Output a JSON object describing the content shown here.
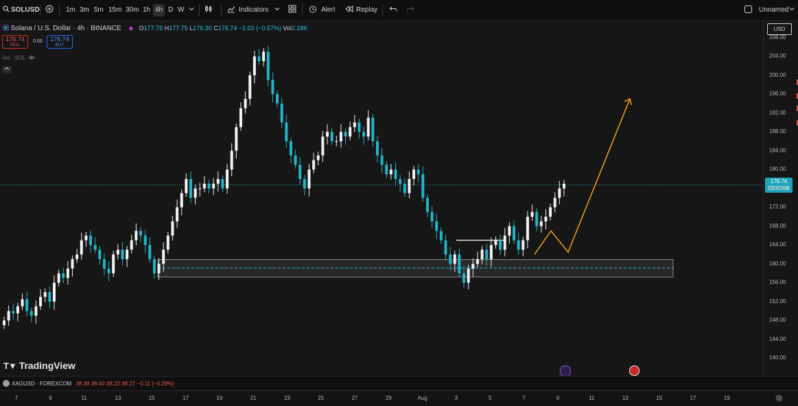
{
  "toolbar": {
    "symbol": "SOLUSD",
    "intervals": [
      "1m",
      "3m",
      "5m",
      "15m",
      "30m",
      "1h",
      "4h",
      "D",
      "W"
    ],
    "active_interval": "4h",
    "indicators_label": "Indicators",
    "alert_label": "Alert",
    "replay_label": "Replay",
    "layout_name": "Unnamed"
  },
  "legend": {
    "title": "Solana / U.S. Dollar · 4h · BINANCE",
    "o_label": "O",
    "o": "177.75",
    "h_label": "H",
    "h": "177.75",
    "l_label": "L",
    "l": "176.30",
    "c_label": "C",
    "c": "176.74",
    "change": "−1.02 (−0.57%)",
    "vol_label": "Vol",
    "vol": "2.18K",
    "volume_label": "Vol · SOL",
    "sell_price": "176.74",
    "sell_label": "SELL",
    "spread": "0.00",
    "buy_price": "176.74",
    "buy_label": "BUY"
  },
  "currency": "USD",
  "last_price": {
    "value": "176.74",
    "countdown": "03:07:08"
  },
  "y_ticks": [
    "208.00",
    "204.00",
    "200.00",
    "196.00",
    "192.00",
    "188.00",
    "184.00",
    "180.00",
    "176.00",
    "172.00",
    "168.00",
    "164.00",
    "160.00",
    "156.00",
    "152.00",
    "148.00",
    "144.00",
    "140.00"
  ],
  "x_ticks": [
    "7",
    "9",
    "11",
    "13",
    "15",
    "17",
    "19",
    "21",
    "23",
    "25",
    "27",
    "29",
    "Aug",
    "3",
    "5",
    "7",
    "9",
    "11",
    "13",
    "15",
    "17",
    "19"
  ],
  "watermark": "TradingView",
  "bottom_ticker": {
    "symbol": "XAGUSD · FOREXCOM",
    "o": "38.38",
    "h": "38.40",
    "l": "38.22",
    "c": "38.27",
    "change": "−0.11 (−0.29%)"
  },
  "colors": {
    "up": "#f2f2f2",
    "down": "#22b5c8",
    "accent": "#f7a21b",
    "last_price_bg": "#1ea5b8",
    "sell": "#d32f2f",
    "buy": "#2962ff"
  },
  "chart_data": {
    "type": "candlestick",
    "ylim": [
      138,
      210
    ],
    "y_scale": "linear",
    "last_close": 176.74,
    "support_zone": {
      "low": 157.2,
      "high": 160.9,
      "mid": 159.1
    },
    "resistance_line": 165.0,
    "projection_path": [
      162,
      167,
      162.5,
      195
    ],
    "candles_close": [
      148,
      150,
      149.5,
      151,
      152.5,
      150,
      149,
      151,
      153,
      154,
      152,
      156,
      158,
      157,
      159,
      161,
      162,
      165,
      166,
      164,
      163,
      161,
      159,
      158,
      162,
      163,
      161,
      163,
      165,
      167,
      166,
      164,
      161,
      158,
      160,
      163,
      166,
      169,
      172,
      175,
      178,
      174,
      176,
      176,
      177,
      176,
      177,
      178,
      176,
      180,
      184,
      189,
      193,
      195,
      200,
      204,
      203,
      205,
      199,
      196,
      194,
      190,
      186,
      183,
      181,
      178,
      176,
      180,
      182,
      183,
      187,
      188,
      186,
      186,
      188,
      187,
      189,
      190,
      188,
      187,
      191,
      186,
      183,
      181,
      179,
      180,
      178,
      177,
      175,
      178,
      180,
      179,
      174,
      171,
      169,
      167,
      165,
      162,
      160,
      162,
      158,
      156,
      159,
      160,
      161,
      163,
      161,
      164,
      165,
      163,
      166,
      168,
      165,
      163,
      165,
      170,
      171,
      168,
      169,
      170,
      172,
      174,
      176,
      177
    ]
  }
}
